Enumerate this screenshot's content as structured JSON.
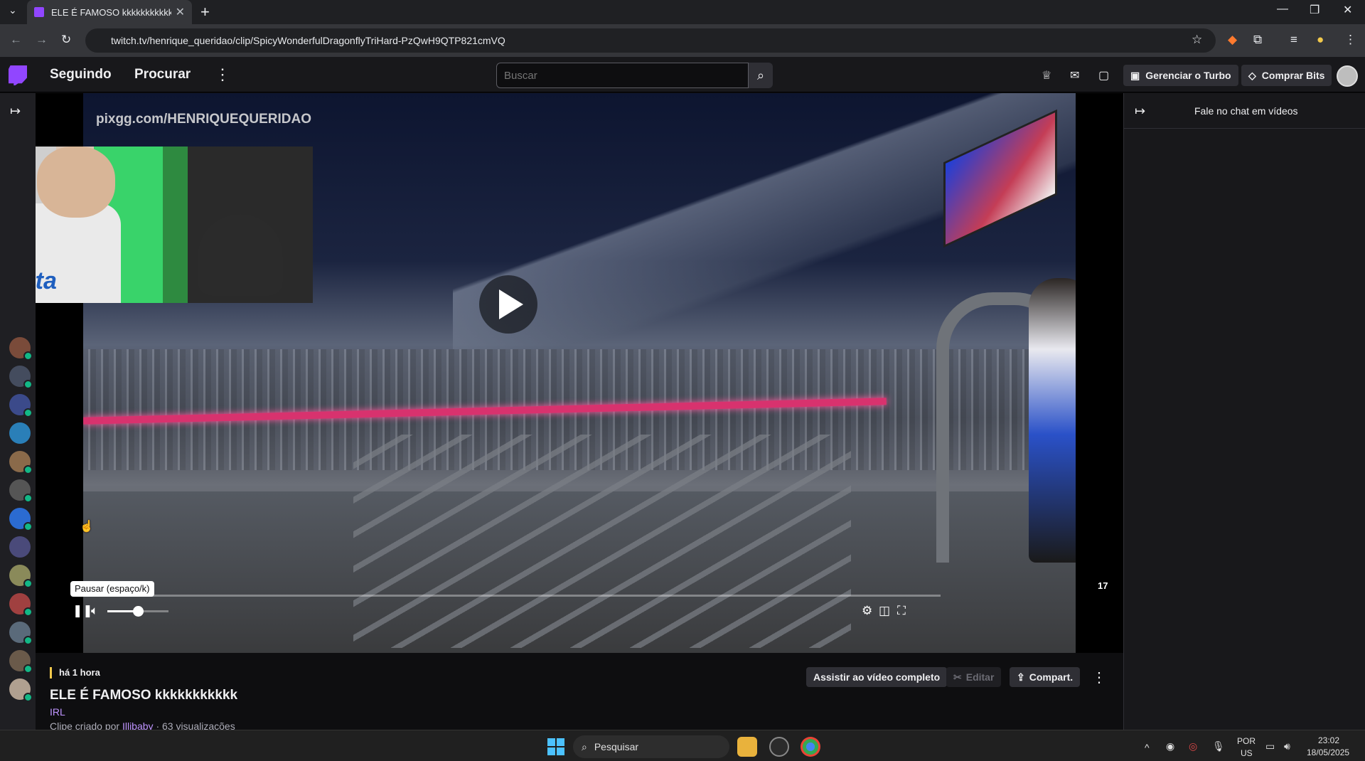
{
  "browser": {
    "tab_title": "ELE É FAMOSO kkkkkkkkkkk -",
    "url": "twitch.tv/henrique_queridao/clip/SpicyWonderfulDragonflyTriHard-PzQwH9QTP821cmVQ",
    "new_tab": "+",
    "close_tab": "✕"
  },
  "nav": {
    "following": "Seguindo",
    "browse": "Procurar",
    "search_placeholder": "Buscar",
    "turbo_label": "Gerenciar o Turbo",
    "bits_label": "Comprar Bits"
  },
  "player": {
    "watermark": "pixgg.com/HENRIQUEQUERIDAO",
    "tooltip": "Pausar (espaço/k)",
    "time_display": "17",
    "progress_fraction": 0.0,
    "volume_fraction": 0.5
  },
  "chat": {
    "title": "Fale no chat em vídeos"
  },
  "clip": {
    "ago": "há 1 hora",
    "title": "ELE É FAMOSO kkkkkkkkkkk",
    "category": "IRL",
    "created_by_prefix": "Clipe criado por",
    "creator": "Illibaby",
    "views": "· 63 visualizações",
    "watch_full": "Assistir ao vídeo completo",
    "edit": "Editar",
    "share": "Compart."
  },
  "taskbar": {
    "search": "Pesquisar",
    "lang_top": "POR",
    "lang_bottom": "US",
    "time": "23:02",
    "date": "18/05/2025"
  },
  "sidebar": {
    "avatar_colors": [
      "#7a4b3a",
      "#444c5e",
      "#3b4a8a",
      "#2a7fb8",
      "#8a6a4a",
      "#555555",
      "#2b6bd1",
      "#4a4a7a",
      "#8a8a5a",
      "#a04040",
      "#5a6a7a",
      "#6a5a4a",
      "#b0a090"
    ]
  },
  "colors": {
    "twitch_purple": "#9146ff",
    "live_green": "#12b886",
    "link_purple": "#bf94ff"
  }
}
